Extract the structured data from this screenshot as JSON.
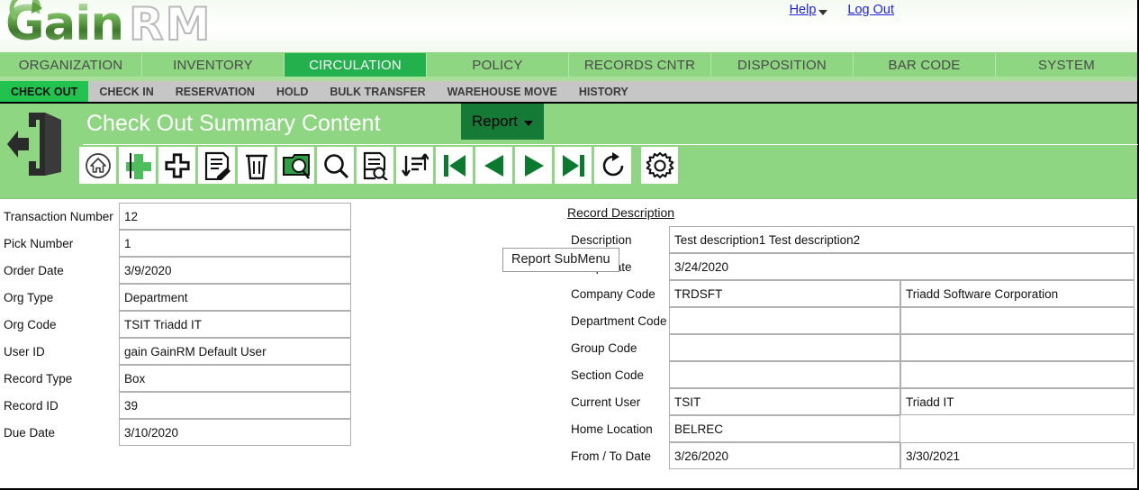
{
  "brand": {
    "name_part1": "Gain",
    "name_part2": "RM"
  },
  "top_links": [
    {
      "label": "Help",
      "has_caret": true
    },
    {
      "label": "Log Out",
      "has_caret": false
    }
  ],
  "main_nav": {
    "active": "CIRCULATION",
    "tabs": [
      {
        "label": "ORGANIZATION"
      },
      {
        "label": "INVENTORY"
      },
      {
        "label": "CIRCULATION"
      },
      {
        "label": "POLICY"
      },
      {
        "label": "RECORDS CNTR"
      },
      {
        "label": "DISPOSITION"
      },
      {
        "label": "BAR CODE"
      },
      {
        "label": "SYSTEM"
      }
    ]
  },
  "sub_nav": {
    "active": "CHECK OUT",
    "items": [
      {
        "label": "CHECK OUT"
      },
      {
        "label": "CHECK IN"
      },
      {
        "label": "RESERVATION"
      },
      {
        "label": "HOLD"
      },
      {
        "label": "BULK TRANSFER"
      },
      {
        "label": "WAREHOUSE MOVE"
      },
      {
        "label": "HISTORY"
      }
    ]
  },
  "title_band": {
    "title": "Check Out Summary Content",
    "report_button": "Report",
    "tooltip": "Report SubMenu",
    "exit_icon": "exit-door-icon"
  },
  "toolbar": {
    "buttons": [
      {
        "name": "home-icon",
        "title": "Home"
      },
      {
        "name": "insert-plus-icon",
        "title": "Insert"
      },
      {
        "name": "add-plus-icon",
        "title": "Add"
      },
      {
        "name": "edit-document-icon",
        "title": "Edit"
      },
      {
        "name": "delete-trash-icon",
        "title": "Delete"
      },
      {
        "name": "scan-camera-icon",
        "title": "Scan"
      },
      {
        "name": "search-magnifier-icon",
        "title": "Search"
      },
      {
        "name": "find-document-icon",
        "title": "Find"
      },
      {
        "name": "sort-arrows-icon",
        "title": "Sort"
      },
      {
        "name": "first-record-icon",
        "title": "First"
      },
      {
        "name": "previous-record-icon",
        "title": "Previous"
      },
      {
        "name": "next-record-icon",
        "title": "Next"
      },
      {
        "name": "last-record-icon",
        "title": "Last"
      },
      {
        "name": "refresh-icon",
        "title": "Refresh"
      },
      {
        "name": "settings-gear-icon",
        "title": "Settings"
      }
    ]
  },
  "form": {
    "left_fields": [
      {
        "label": "Transaction Number",
        "value": "12"
      },
      {
        "label": "Pick Number",
        "value": "1"
      },
      {
        "label": "Order Date",
        "value": "3/9/2020"
      },
      {
        "label": "Org Type",
        "value": "Department"
      },
      {
        "label": "Org Code",
        "value": "TSIT   Triadd IT"
      },
      {
        "label": "User ID",
        "value": "gain   GainRM Default User"
      },
      {
        "label": "Record Type",
        "value": "Box"
      },
      {
        "label": "Record ID",
        "value": "39"
      },
      {
        "label": "Due Date",
        "value": "3/10/2020"
      }
    ],
    "right_section_title": "Record Description ",
    "right_fields": [
      {
        "label": "Description",
        "value": "Test description1   Test description2",
        "value2": null,
        "split": false
      },
      {
        "label": "Setup Date",
        "value": "3/24/2020",
        "value2": null,
        "split": false
      },
      {
        "label": "Company Code",
        "value": "TRDSFT",
        "value2": "Triadd Software Corporation",
        "split": true
      },
      {
        "label": "Department Code",
        "value": "",
        "value2": "",
        "split": true
      },
      {
        "label": "Group Code",
        "value": "",
        "value2": "",
        "split": true
      },
      {
        "label": "Section Code",
        "value": "",
        "value2": "",
        "split": true
      },
      {
        "label": "Current User",
        "value": "TSIT",
        "value2": "Triadd IT",
        "split": true
      },
      {
        "label": "Home Location",
        "value": "BELREC",
        "value2": "",
        "split": true,
        "second_borderless": true
      },
      {
        "label": "From / To Date",
        "value": "3/26/2020",
        "value2": "3/30/2021",
        "split": true
      }
    ]
  },
  "colors": {
    "nav_green": "#8ed681",
    "active_green": "#22b14c",
    "subnav_gray": "#c6c6c6",
    "report_green": "#157a36",
    "link_blue": "#2020dd"
  }
}
